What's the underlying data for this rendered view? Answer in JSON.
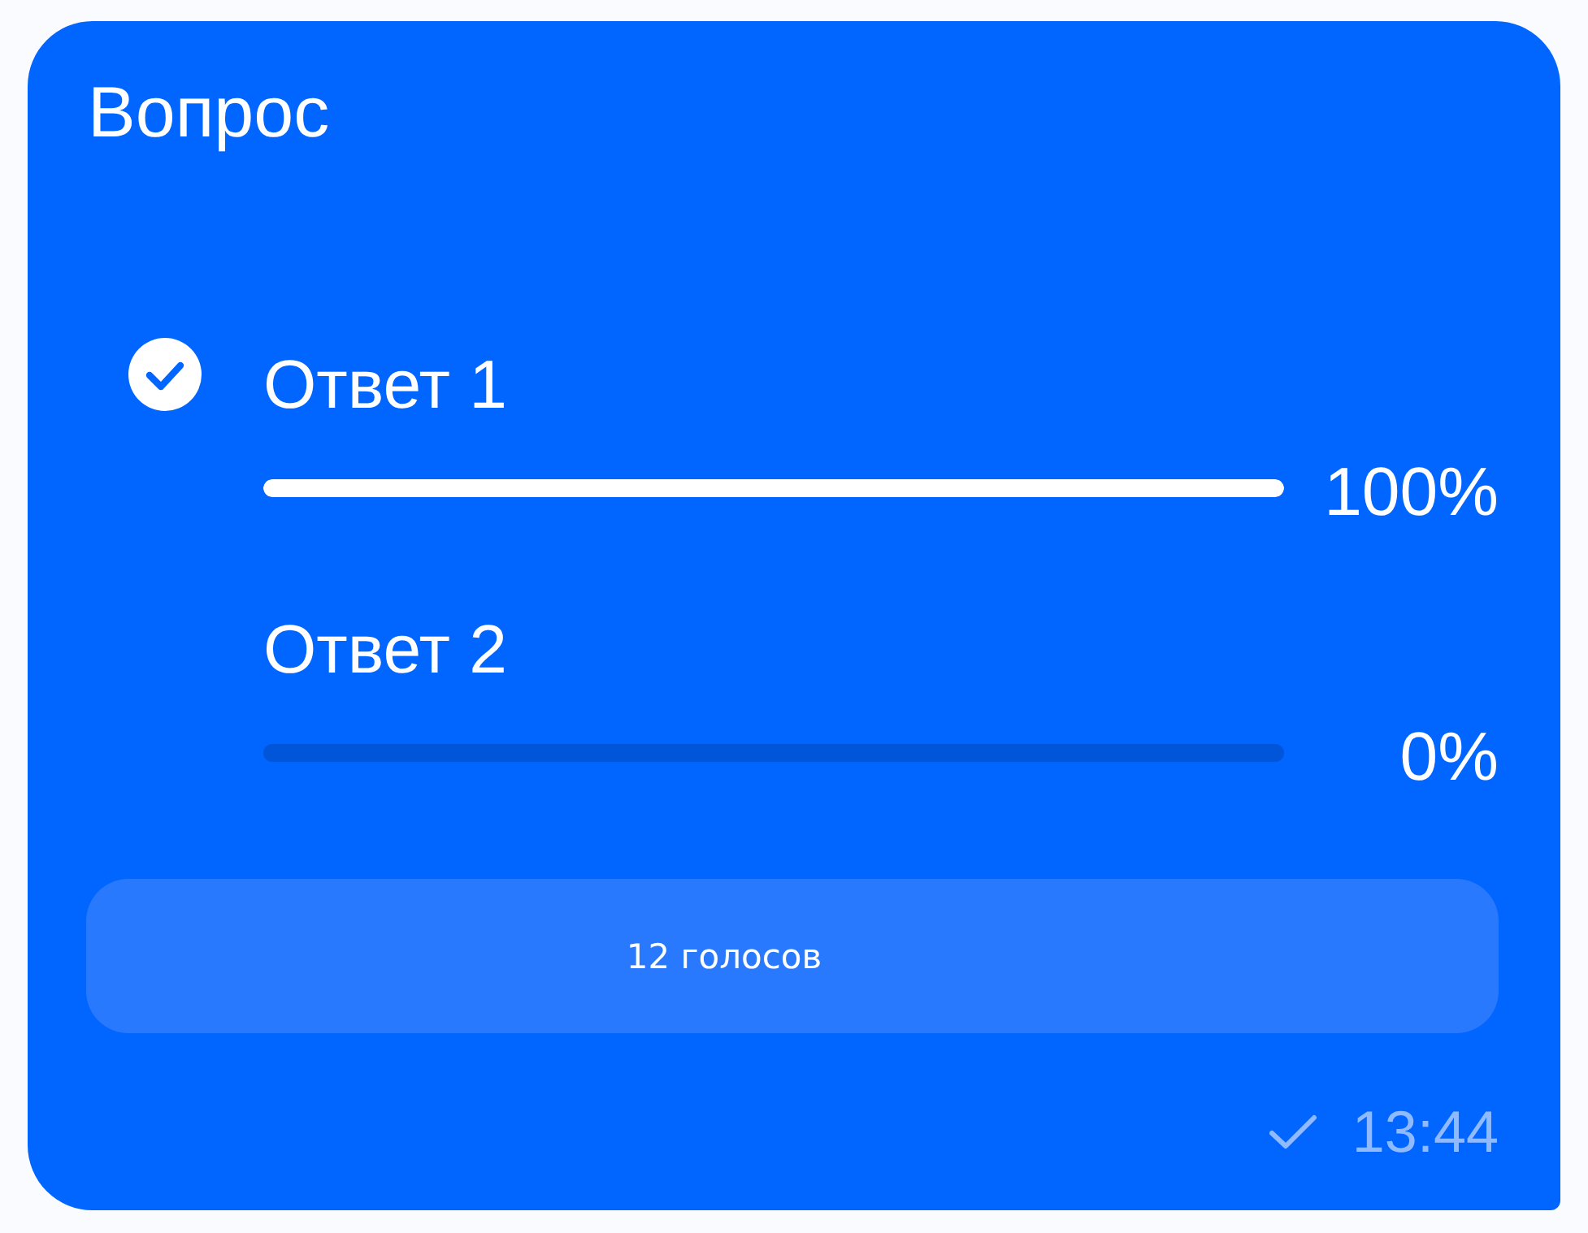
{
  "message": {
    "title": "Вопрос",
    "options": [
      {
        "label": "Ответ 1",
        "level": 1,
        "percent": "100%",
        "selected": true
      },
      {
        "label": "Ответ 2",
        "level": 0,
        "percent": "0%",
        "selected": false
      }
    ],
    "votes_button": "12 голосов",
    "time": "13:44"
  }
}
